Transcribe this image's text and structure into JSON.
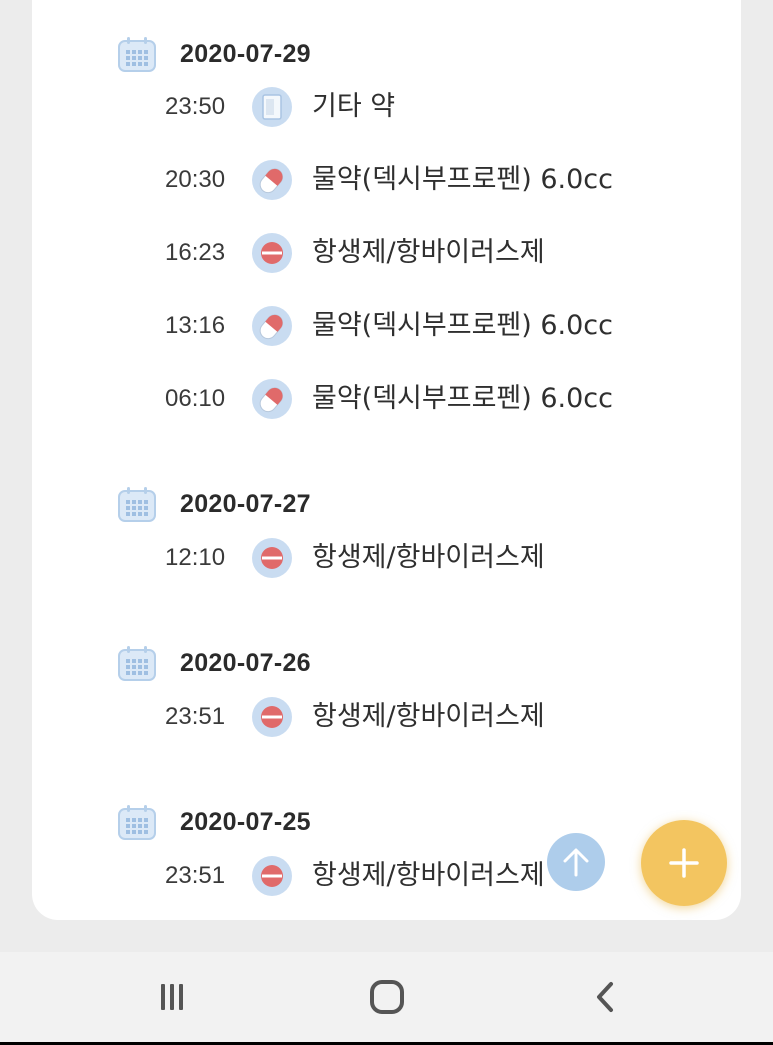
{
  "groups": [
    {
      "date": "2020-07-29",
      "entries": [
        {
          "time": "23:50",
          "name": "기타 약",
          "icon": "other-medicine-icon"
        },
        {
          "time": "20:30",
          "name": "물약(덱시부프로펜) 6.0cc",
          "icon": "liquid-medicine-icon"
        },
        {
          "time": "16:23",
          "name": "항생제/항바이러스제",
          "icon": "antibiotic-icon"
        },
        {
          "time": "13:16",
          "name": "물약(덱시부프로펜) 6.0cc",
          "icon": "liquid-medicine-icon"
        },
        {
          "time": "06:10",
          "name": "물약(덱시부프로펜) 6.0cc",
          "icon": "liquid-medicine-icon"
        }
      ]
    },
    {
      "date": "2020-07-27",
      "entries": [
        {
          "time": "12:10",
          "name": "항생제/항바이러스제",
          "icon": "antibiotic-icon"
        }
      ]
    },
    {
      "date": "2020-07-26",
      "entries": [
        {
          "time": "23:51",
          "name": "항생제/항바이러스제",
          "icon": "antibiotic-icon"
        }
      ]
    },
    {
      "date": "2020-07-25",
      "entries": [
        {
          "time": "23:51",
          "name": "항생제/항바이러스제",
          "icon": "antibiotic-icon"
        }
      ]
    }
  ],
  "actions": {
    "scroll_top_icon": "arrow-up-icon",
    "add_icon": "plus-icon"
  },
  "navbar": {
    "recents_icon": "recents-icon",
    "home_icon": "home-icon",
    "back_icon": "back-icon"
  },
  "colors": {
    "icon_bg": "#c9dcf1",
    "pill_red": "#e06a6a",
    "fab": "#f3c560",
    "scroll_button": "#a0c4e8"
  }
}
